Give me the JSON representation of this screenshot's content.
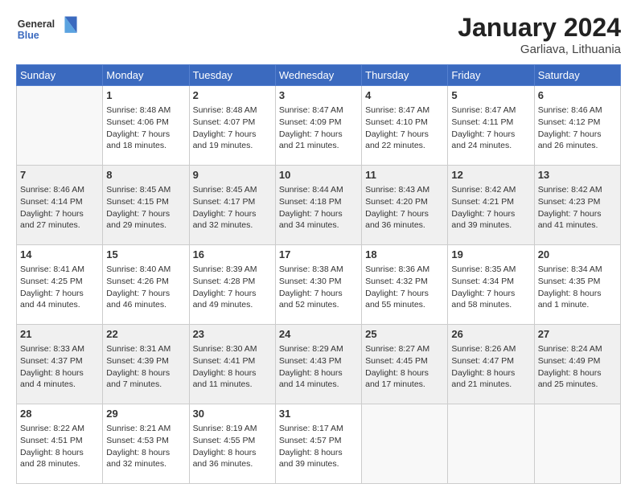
{
  "header": {
    "logo_line1": "General",
    "logo_line2": "Blue",
    "month": "January 2024",
    "location": "Garliava, Lithuania"
  },
  "weekdays": [
    "Sunday",
    "Monday",
    "Tuesday",
    "Wednesday",
    "Thursday",
    "Friday",
    "Saturday"
  ],
  "weeks": [
    [
      {
        "day": "",
        "info": ""
      },
      {
        "day": "1",
        "info": "Sunrise: 8:48 AM\nSunset: 4:06 PM\nDaylight: 7 hours\nand 18 minutes."
      },
      {
        "day": "2",
        "info": "Sunrise: 8:48 AM\nSunset: 4:07 PM\nDaylight: 7 hours\nand 19 minutes."
      },
      {
        "day": "3",
        "info": "Sunrise: 8:47 AM\nSunset: 4:09 PM\nDaylight: 7 hours\nand 21 minutes."
      },
      {
        "day": "4",
        "info": "Sunrise: 8:47 AM\nSunset: 4:10 PM\nDaylight: 7 hours\nand 22 minutes."
      },
      {
        "day": "5",
        "info": "Sunrise: 8:47 AM\nSunset: 4:11 PM\nDaylight: 7 hours\nand 24 minutes."
      },
      {
        "day": "6",
        "info": "Sunrise: 8:46 AM\nSunset: 4:12 PM\nDaylight: 7 hours\nand 26 minutes."
      }
    ],
    [
      {
        "day": "7",
        "info": "Sunrise: 8:46 AM\nSunset: 4:14 PM\nDaylight: 7 hours\nand 27 minutes."
      },
      {
        "day": "8",
        "info": "Sunrise: 8:45 AM\nSunset: 4:15 PM\nDaylight: 7 hours\nand 29 minutes."
      },
      {
        "day": "9",
        "info": "Sunrise: 8:45 AM\nSunset: 4:17 PM\nDaylight: 7 hours\nand 32 minutes."
      },
      {
        "day": "10",
        "info": "Sunrise: 8:44 AM\nSunset: 4:18 PM\nDaylight: 7 hours\nand 34 minutes."
      },
      {
        "day": "11",
        "info": "Sunrise: 8:43 AM\nSunset: 4:20 PM\nDaylight: 7 hours\nand 36 minutes."
      },
      {
        "day": "12",
        "info": "Sunrise: 8:42 AM\nSunset: 4:21 PM\nDaylight: 7 hours\nand 39 minutes."
      },
      {
        "day": "13",
        "info": "Sunrise: 8:42 AM\nSunset: 4:23 PM\nDaylight: 7 hours\nand 41 minutes."
      }
    ],
    [
      {
        "day": "14",
        "info": "Sunrise: 8:41 AM\nSunset: 4:25 PM\nDaylight: 7 hours\nand 44 minutes."
      },
      {
        "day": "15",
        "info": "Sunrise: 8:40 AM\nSunset: 4:26 PM\nDaylight: 7 hours\nand 46 minutes."
      },
      {
        "day": "16",
        "info": "Sunrise: 8:39 AM\nSunset: 4:28 PM\nDaylight: 7 hours\nand 49 minutes."
      },
      {
        "day": "17",
        "info": "Sunrise: 8:38 AM\nSunset: 4:30 PM\nDaylight: 7 hours\nand 52 minutes."
      },
      {
        "day": "18",
        "info": "Sunrise: 8:36 AM\nSunset: 4:32 PM\nDaylight: 7 hours\nand 55 minutes."
      },
      {
        "day": "19",
        "info": "Sunrise: 8:35 AM\nSunset: 4:34 PM\nDaylight: 7 hours\nand 58 minutes."
      },
      {
        "day": "20",
        "info": "Sunrise: 8:34 AM\nSunset: 4:35 PM\nDaylight: 8 hours\nand 1 minute."
      }
    ],
    [
      {
        "day": "21",
        "info": "Sunrise: 8:33 AM\nSunset: 4:37 PM\nDaylight: 8 hours\nand 4 minutes."
      },
      {
        "day": "22",
        "info": "Sunrise: 8:31 AM\nSunset: 4:39 PM\nDaylight: 8 hours\nand 7 minutes."
      },
      {
        "day": "23",
        "info": "Sunrise: 8:30 AM\nSunset: 4:41 PM\nDaylight: 8 hours\nand 11 minutes."
      },
      {
        "day": "24",
        "info": "Sunrise: 8:29 AM\nSunset: 4:43 PM\nDaylight: 8 hours\nand 14 minutes."
      },
      {
        "day": "25",
        "info": "Sunrise: 8:27 AM\nSunset: 4:45 PM\nDaylight: 8 hours\nand 17 minutes."
      },
      {
        "day": "26",
        "info": "Sunrise: 8:26 AM\nSunset: 4:47 PM\nDaylight: 8 hours\nand 21 minutes."
      },
      {
        "day": "27",
        "info": "Sunrise: 8:24 AM\nSunset: 4:49 PM\nDaylight: 8 hours\nand 25 minutes."
      }
    ],
    [
      {
        "day": "28",
        "info": "Sunrise: 8:22 AM\nSunset: 4:51 PM\nDaylight: 8 hours\nand 28 minutes."
      },
      {
        "day": "29",
        "info": "Sunrise: 8:21 AM\nSunset: 4:53 PM\nDaylight: 8 hours\nand 32 minutes."
      },
      {
        "day": "30",
        "info": "Sunrise: 8:19 AM\nSunset: 4:55 PM\nDaylight: 8 hours\nand 36 minutes."
      },
      {
        "day": "31",
        "info": "Sunrise: 8:17 AM\nSunset: 4:57 PM\nDaylight: 8 hours\nand 39 minutes."
      },
      {
        "day": "",
        "info": ""
      },
      {
        "day": "",
        "info": ""
      },
      {
        "day": "",
        "info": ""
      }
    ]
  ]
}
